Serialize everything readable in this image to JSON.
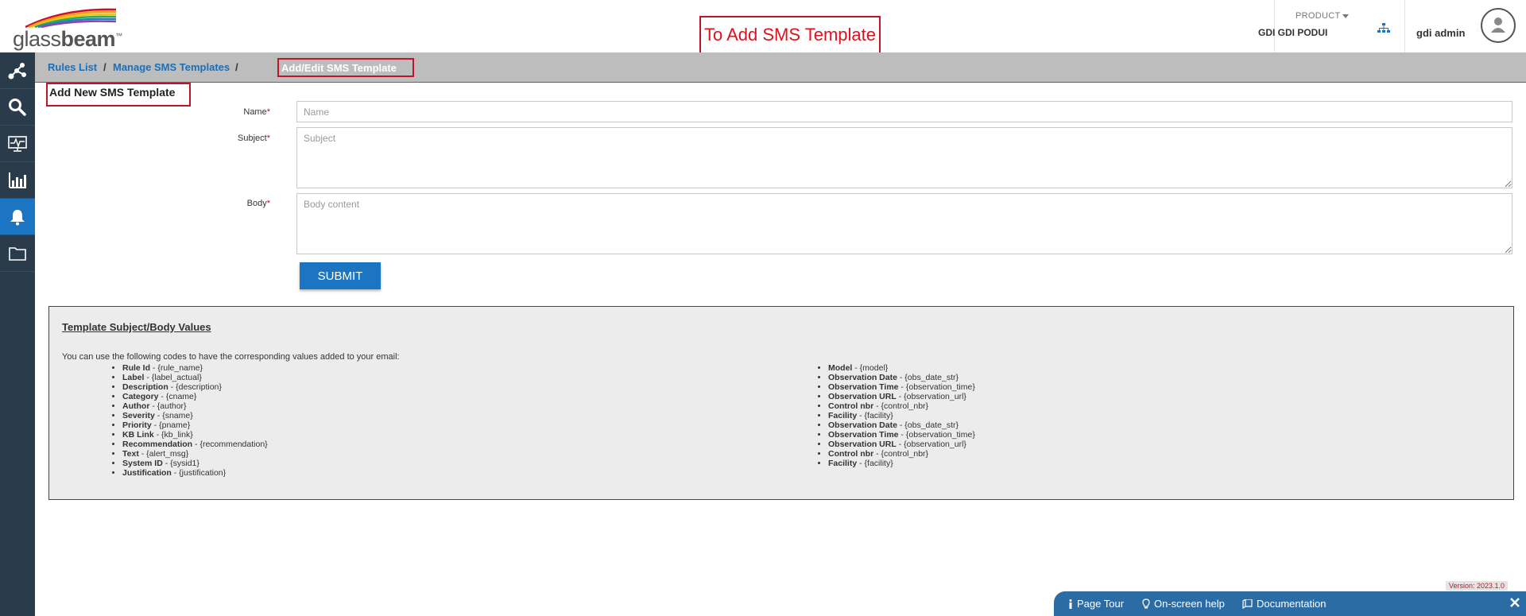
{
  "header": {
    "logo_text_light": "glass",
    "logo_text_bold": "beam",
    "logo_tm": "™",
    "callout": "To Add SMS Template",
    "product_label": "PRODUCT",
    "product_value": "GDI GDI PODUI",
    "user_name": "gdi admin"
  },
  "sidebar": {
    "items": [
      {
        "icon": "network-graph-icon"
      },
      {
        "icon": "search-icon"
      },
      {
        "icon": "monitor-pulse-icon"
      },
      {
        "icon": "bar-chart-icon"
      },
      {
        "icon": "bell-icon",
        "active": true
      },
      {
        "icon": "folder-icon"
      }
    ]
  },
  "breadcrumb": {
    "rules_list": "Rules List",
    "manage": "Manage SMS Templates",
    "current": "Add/Edit SMS Template",
    "separator": "/"
  },
  "form": {
    "title": "Add New SMS Template",
    "name_label": "Name",
    "name_placeholder": "Name",
    "subject_label": "Subject",
    "subject_placeholder": "Subject",
    "body_label": "Body",
    "body_placeholder": "Body content",
    "required_mark": "*",
    "submit_label": "SUBMIT"
  },
  "info": {
    "title": "Template Subject/Body Values",
    "intro": "You can use the following codes to have the corresponding values added to your email:",
    "left_codes": [
      {
        "name": "Rule Id",
        "code": " - {rule_name}"
      },
      {
        "name": "Label",
        "code": " - {label_actual}"
      },
      {
        "name": "Description",
        "code": " - {description}"
      },
      {
        "name": "Category",
        "code": " - {cname}"
      },
      {
        "name": "Author",
        "code": " - {author}"
      },
      {
        "name": "Severity",
        "code": " - {sname}"
      },
      {
        "name": "Priority",
        "code": " - {pname}"
      },
      {
        "name": "KB Link",
        "code": " - {kb_link}"
      },
      {
        "name": "Recommendation",
        "code": " - {recommendation}"
      },
      {
        "name": "Text",
        "code": " - {alert_msg}"
      },
      {
        "name": "System ID",
        "code": " - {sysid1}"
      },
      {
        "name": "Justification",
        "code": " - {justification}"
      }
    ],
    "right_codes": [
      {
        "name": "Model",
        "code": " - {model}"
      },
      {
        "name": "Observation Date",
        "code": " - {obs_date_str}"
      },
      {
        "name": "Observation Time",
        "code": " - {observation_time}"
      },
      {
        "name": "Observation URL",
        "code": " - {observation_url}"
      },
      {
        "name": "Control nbr",
        "code": " - {control_nbr}"
      },
      {
        "name": "Facility",
        "code": " - {facility}"
      },
      {
        "name": "Observation Date",
        "code": " - {obs_date_str}"
      },
      {
        "name": "Observation Time",
        "code": " - {observation_time}"
      },
      {
        "name": "Observation URL",
        "code": " - {observation_url}"
      },
      {
        "name": "Control nbr",
        "code": " - {control_nbr}"
      },
      {
        "name": "Facility",
        "code": " - {facility}"
      }
    ]
  },
  "footer": {
    "version": "Version: 2023.1.0",
    "page_tour": "Page Tour",
    "onscreen_help": "On-screen help",
    "documentation": "Documentation"
  },
  "colors": {
    "accent": "#1b75c2",
    "sidebar": "#2a3b4b",
    "highlight_border": "#c0142b"
  }
}
